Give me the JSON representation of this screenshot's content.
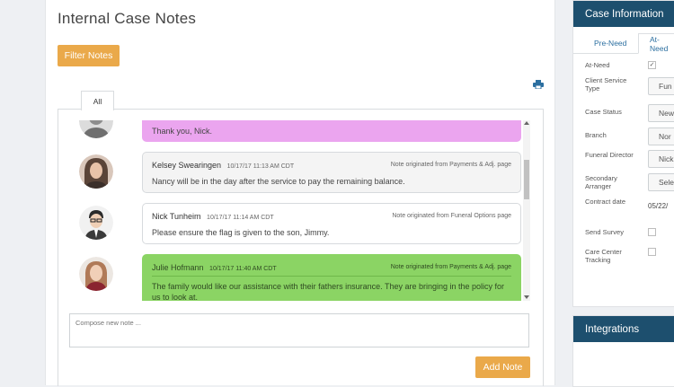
{
  "page": {
    "title": "Internal Case Notes",
    "filter_button": "Filter Notes",
    "tabs": [
      "All"
    ],
    "print_icon": "print-icon"
  },
  "notes": [
    {
      "author": "",
      "timestamp": "",
      "origin": "",
      "text": "Thank you, Nick.",
      "style": "pink",
      "avatar_color": "#8d8d8d"
    },
    {
      "author": "Kelsey Swearingen",
      "timestamp": "10/17/17 11:13 AM CDT",
      "origin": "Note originated from Payments & Adj. page",
      "text": "Nancy will be in the day after the service to pay the remaining balance.",
      "style": "grey",
      "avatar_color": "#5a4438"
    },
    {
      "author": "Nick Tunheim",
      "timestamp": "10/17/17 11:14 AM CDT",
      "origin": "Note originated from Funeral Options page",
      "text": "Please ensure the flag is given to the son, Jimmy.",
      "style": "white",
      "avatar_color": "#3a3a3a"
    },
    {
      "author": "Julie Hofmann",
      "timestamp": "10/17/17 11:40 AM CDT",
      "origin": "Note originated from Payments & Adj. page",
      "text": "The family would like our assistance with their fathers insurance. They are bringing in the policy for us to look at.",
      "style": "green",
      "avatar_color": "#b07a58"
    }
  ],
  "compose": {
    "placeholder": "Compose new note ..."
  },
  "add_button": "Add Note",
  "sidebar": {
    "title": "Case Information",
    "tabs": [
      "Pre-Need",
      "At-Need"
    ],
    "fields": [
      {
        "label": "At-Need",
        "type": "checkbox",
        "checked": true,
        "value": "✓"
      },
      {
        "label": "Client Service Type",
        "type": "select",
        "value": "Fun"
      },
      {
        "label": "Case Status",
        "type": "select",
        "value": "New"
      },
      {
        "label": "Branch",
        "type": "select",
        "value": "Nor"
      },
      {
        "label": "Funeral Director",
        "type": "select",
        "value": "Nick"
      },
      {
        "label": "Secondary Arranger",
        "type": "select",
        "value": "Sele"
      },
      {
        "label": "Contract date",
        "type": "text",
        "value": "05/22/"
      },
      {
        "label": "Send Survey",
        "type": "checkbox",
        "checked": false,
        "value": ""
      },
      {
        "label": "Care Center Tracking",
        "type": "checkbox",
        "checked": false,
        "value": ""
      }
    ]
  },
  "integrations": {
    "title": "Integrations"
  },
  "colors": {
    "accent_orange": "#eaa94a",
    "header_navy": "#1d4f6e",
    "note_pink": "#eba5ef",
    "note_green": "#8bd464"
  }
}
